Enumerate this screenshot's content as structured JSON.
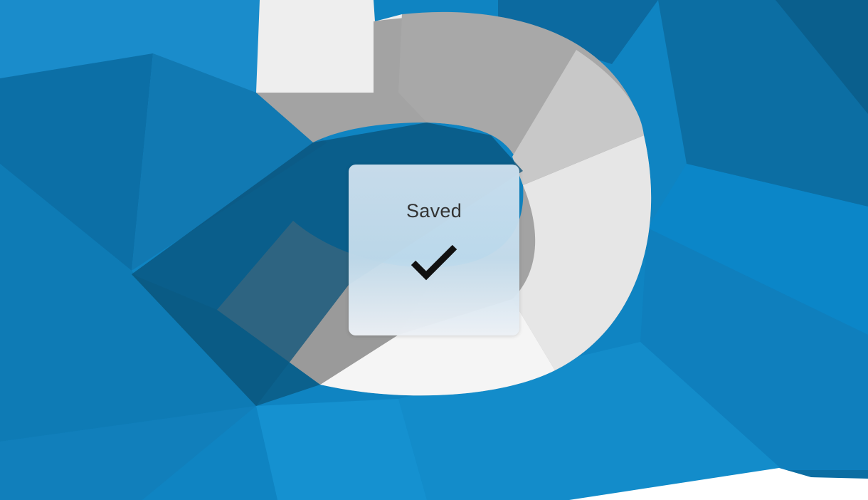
{
  "hud": {
    "title": "Saved",
    "icon": "checkmark-icon"
  },
  "wallpaper": {
    "base_color": "#0f84c2",
    "shape_color": "#ededed",
    "shadow_color": "#0a5278"
  }
}
